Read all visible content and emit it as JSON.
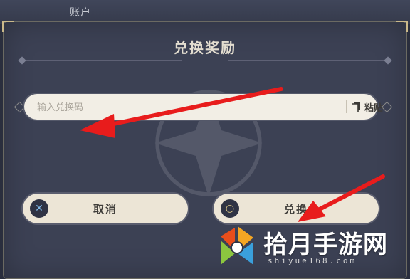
{
  "background": {
    "account_label": "账户"
  },
  "dialog": {
    "title": "兑换奖励",
    "input": {
      "value": "",
      "placeholder": "输入兑换码"
    },
    "paste_label": "粘贴",
    "cancel_label": "取消",
    "confirm_label": "兑换"
  },
  "annotations": {
    "arrow_color": "#e81c1c",
    "arrow_count": 2
  },
  "watermark": {
    "brand": "拾月手游网",
    "domain": "shiyue168.com"
  },
  "colors": {
    "panel": "#3c4154",
    "input_bg": "#f2eee5",
    "button_bg": "#ece5d6",
    "title": "#e3ddd0",
    "accent_gold": "#cbb98a"
  },
  "icons": {
    "paste": "clipboard-icon",
    "cancel": "close-icon",
    "confirm": "check-icon",
    "watermark": "logo-icon"
  }
}
